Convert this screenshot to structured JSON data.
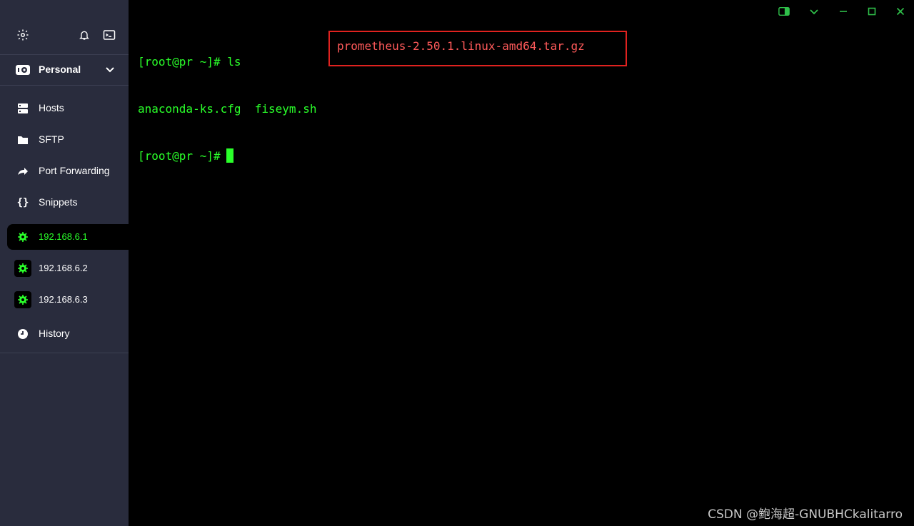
{
  "sidebar": {
    "vault": {
      "label": "Personal"
    },
    "nav": [
      {
        "label": "Hosts"
      },
      {
        "label": "SFTP"
      },
      {
        "label": "Port Forwarding"
      },
      {
        "label": "Snippets"
      }
    ],
    "hosts": [
      {
        "label": "192.168.6.1",
        "active": true
      },
      {
        "label": "192.168.6.2",
        "active": false
      },
      {
        "label": "192.168.6.3",
        "active": false
      }
    ],
    "history": {
      "label": "History"
    }
  },
  "terminal": {
    "line1": "[root@pr ~]# ls",
    "files": [
      "anaconda-ks.cfg",
      "fiseym.sh"
    ],
    "highlighted_file": "prometheus-2.50.1.linux-amd64.tar.gz",
    "line3": "[root@pr ~]#"
  },
  "colors": {
    "terminal_green": "#2aff2a",
    "highlight_red": "#e0221f",
    "sidebar_bg": "#292c3d",
    "window_control_green": "#2fbf4a"
  },
  "watermark": "CSDN @鲍海超-GNUBHCkalitarro"
}
